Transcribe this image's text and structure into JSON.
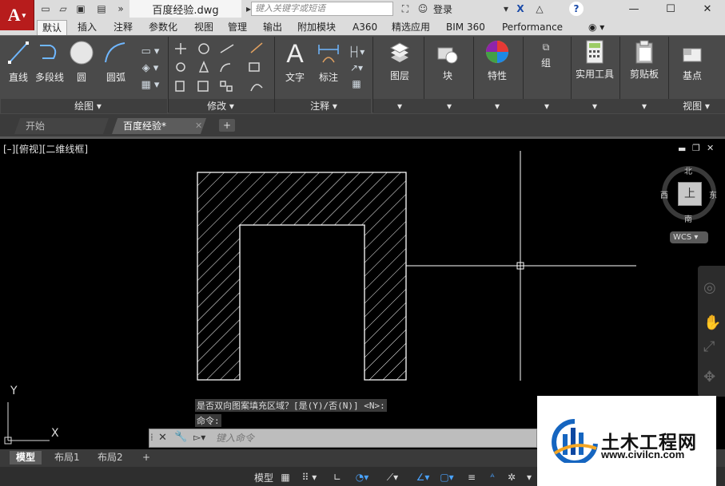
{
  "title_bar": {
    "file_name": "百度经验.dwg",
    "search_placeholder": "键入关键字或短语",
    "login_label": "登录",
    "help": "?"
  },
  "ribbon_tabs": [
    "默认",
    "插入",
    "注释",
    "参数化",
    "视图",
    "管理",
    "输出",
    "附加模块",
    "A360",
    "精选应用",
    "BIM 360",
    "Performance"
  ],
  "panels": {
    "draw": {
      "title": "绘图 ▾",
      "tools": [
        "直线",
        "多段线",
        "圆",
        "圆弧"
      ]
    },
    "modify": {
      "title": "修改 ▾"
    },
    "annotation": {
      "title": "注释 ▾",
      "tools": [
        "文字",
        "标注"
      ]
    },
    "layers": {
      "label": "图层"
    },
    "block": {
      "label": "块"
    },
    "properties": {
      "label": "特性"
    },
    "group": {
      "label": "组"
    },
    "utilities": {
      "label": "实用工具"
    },
    "clipboard": {
      "label": "剪贴板"
    },
    "view": {
      "label": "基点",
      "title": "视图 ▾"
    }
  },
  "doc_tabs": [
    "开始",
    "百度经验*"
  ],
  "viewport": {
    "controls": "[–][俯视][二维线框]",
    "navcube": {
      "north": "北",
      "south": "南",
      "east": "东",
      "west": "西",
      "top": "上",
      "wcs": "WCS"
    },
    "ucs": {
      "x": "X",
      "y": "Y"
    }
  },
  "command": {
    "history": [
      "是否双向图案填充区域？[是(Y)/否(N)] <N>:",
      "命令:"
    ],
    "input_placeholder": "键入命令"
  },
  "layout_tabs": [
    "模型",
    "布局1",
    "布局2"
  ],
  "status_bar": {
    "model_label": "模型"
  },
  "watermark": {
    "brand": "土木工程网",
    "url": "www.civilcn.com"
  },
  "colors": {
    "app_red": "#b71c1c",
    "ribbon": "#4a4a4a",
    "canvas": "#000000",
    "hatch": "#ffffff",
    "brand_blue": "#1565c0"
  }
}
